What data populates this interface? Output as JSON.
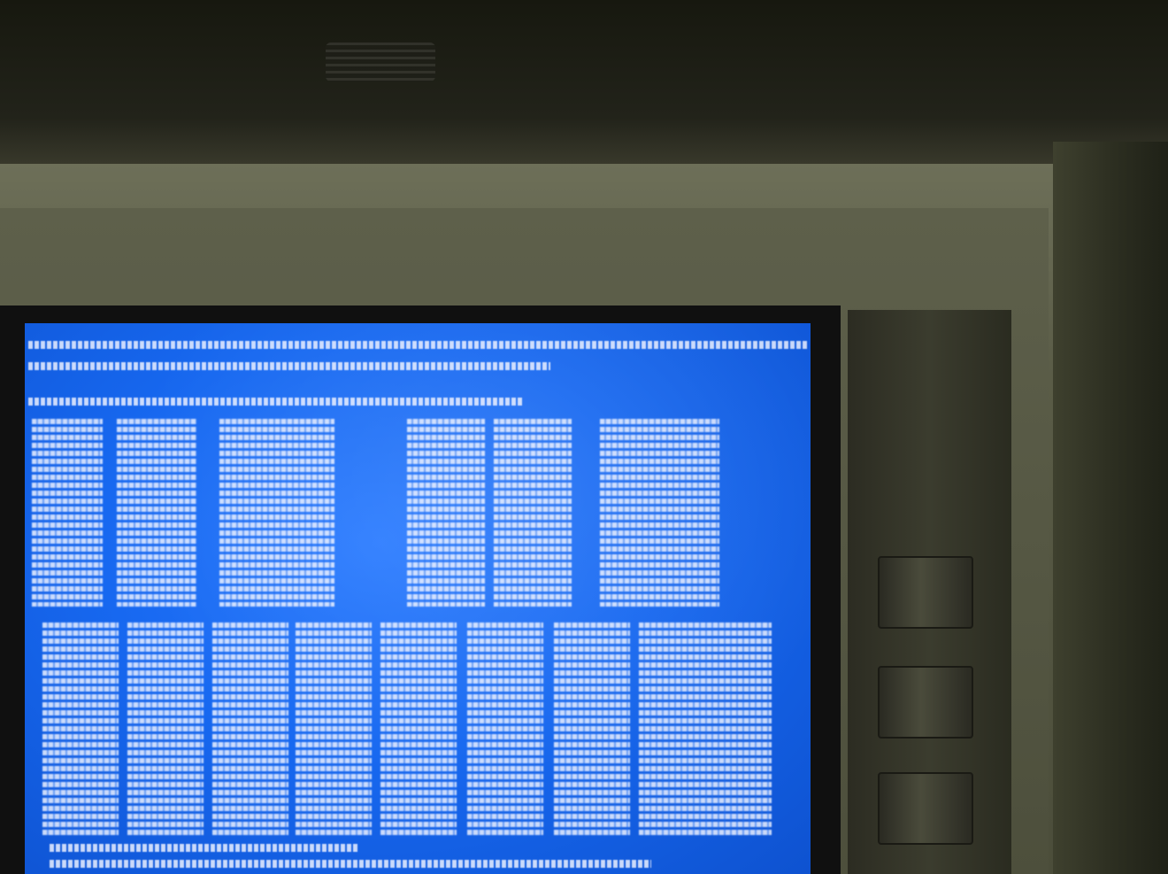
{
  "scene": {
    "description_kind": "photo",
    "screen": {
      "background_color": "#1768f0",
      "text_color": "#ebf0ff"
    },
    "bezel_color": "#5a5c47",
    "wall_color": "#1b1d12"
  }
}
